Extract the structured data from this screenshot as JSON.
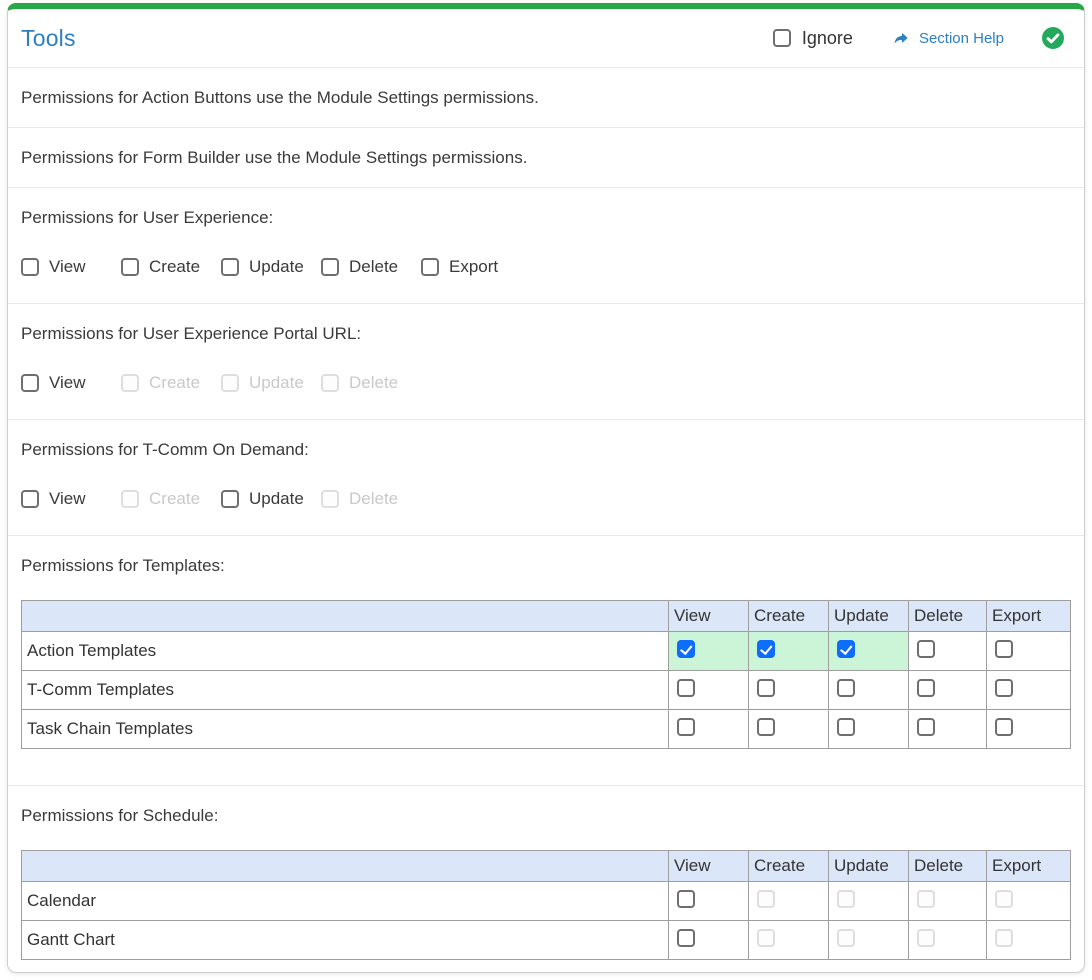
{
  "panel": {
    "title": "Tools",
    "header": {
      "ignore_label": "Ignore",
      "ignore_checked": false,
      "section_help_label": "Section Help",
      "status_icon": "check-circle"
    },
    "sections": [
      {
        "type": "note",
        "text": "Permissions for Action Buttons use the Module Settings permissions."
      },
      {
        "type": "note",
        "text": "Permissions for Form Builder use the Module Settings permissions."
      },
      {
        "type": "checkboxes",
        "label": "Permissions for User Experience:",
        "options": [
          {
            "label": "View",
            "checked": false,
            "disabled": false
          },
          {
            "label": "Create",
            "checked": false,
            "disabled": false
          },
          {
            "label": "Update",
            "checked": false,
            "disabled": false
          },
          {
            "label": "Delete",
            "checked": false,
            "disabled": false
          },
          {
            "label": "Export",
            "checked": false,
            "disabled": false
          }
        ]
      },
      {
        "type": "checkboxes",
        "label": "Permissions for User Experience Portal URL:",
        "options": [
          {
            "label": "View",
            "checked": false,
            "disabled": false
          },
          {
            "label": "Create",
            "checked": false,
            "disabled": true
          },
          {
            "label": "Update",
            "checked": false,
            "disabled": true
          },
          {
            "label": "Delete",
            "checked": false,
            "disabled": true
          }
        ]
      },
      {
        "type": "checkboxes",
        "label": "Permissions for T-Comm On Demand:",
        "options": [
          {
            "label": "View",
            "checked": false,
            "disabled": false
          },
          {
            "label": "Create",
            "checked": false,
            "disabled": true
          },
          {
            "label": "Update",
            "checked": false,
            "disabled": false
          },
          {
            "label": "Delete",
            "checked": false,
            "disabled": true
          }
        ]
      },
      {
        "type": "table",
        "label": "Permissions for Templates:",
        "columns": [
          "View",
          "Create",
          "Update",
          "Delete",
          "Export"
        ],
        "rows": [
          {
            "label": "Action Templates",
            "cells": [
              {
                "checked": true,
                "disabled": false,
                "highlight": true
              },
              {
                "checked": true,
                "disabled": false,
                "highlight": true
              },
              {
                "checked": true,
                "disabled": false,
                "highlight": true
              },
              {
                "checked": false,
                "disabled": false,
                "highlight": false
              },
              {
                "checked": false,
                "disabled": false,
                "highlight": false
              }
            ]
          },
          {
            "label": "T-Comm Templates",
            "cells": [
              {
                "checked": false,
                "disabled": false,
                "highlight": false
              },
              {
                "checked": false,
                "disabled": false,
                "highlight": false
              },
              {
                "checked": false,
                "disabled": false,
                "highlight": false
              },
              {
                "checked": false,
                "disabled": false,
                "highlight": false
              },
              {
                "checked": false,
                "disabled": false,
                "highlight": false
              }
            ]
          },
          {
            "label": "Task Chain Templates",
            "cells": [
              {
                "checked": false,
                "disabled": false,
                "highlight": false
              },
              {
                "checked": false,
                "disabled": false,
                "highlight": false
              },
              {
                "checked": false,
                "disabled": false,
                "highlight": false
              },
              {
                "checked": false,
                "disabled": false,
                "highlight": false
              },
              {
                "checked": false,
                "disabled": false,
                "highlight": false
              }
            ]
          }
        ]
      },
      {
        "type": "table",
        "label": "Permissions for Schedule:",
        "columns": [
          "View",
          "Create",
          "Update",
          "Delete",
          "Export"
        ],
        "rows": [
          {
            "label": "Calendar",
            "cells": [
              {
                "checked": false,
                "disabled": false,
                "highlight": false
              },
              {
                "checked": false,
                "disabled": true,
                "highlight": false
              },
              {
                "checked": false,
                "disabled": true,
                "highlight": false
              },
              {
                "checked": false,
                "disabled": true,
                "highlight": false
              },
              {
                "checked": false,
                "disabled": true,
                "highlight": false
              }
            ]
          },
          {
            "label": "Gantt Chart",
            "cells": [
              {
                "checked": false,
                "disabled": false,
                "highlight": false
              },
              {
                "checked": false,
                "disabled": true,
                "highlight": false
              },
              {
                "checked": false,
                "disabled": true,
                "highlight": false
              },
              {
                "checked": false,
                "disabled": true,
                "highlight": false
              },
              {
                "checked": false,
                "disabled": true,
                "highlight": false
              }
            ]
          }
        ]
      }
    ],
    "colors": {
      "accent_top_bar_green": "#27a745",
      "title_blue": "#2b80c4",
      "link_blue": "#2b80c4",
      "checkbox_checked_blue": "#0d6efd",
      "checked_cell_green": "#ccf5d8",
      "table_header_bg": "#dbe6f9",
      "status_check_green": "#22a95c"
    }
  }
}
